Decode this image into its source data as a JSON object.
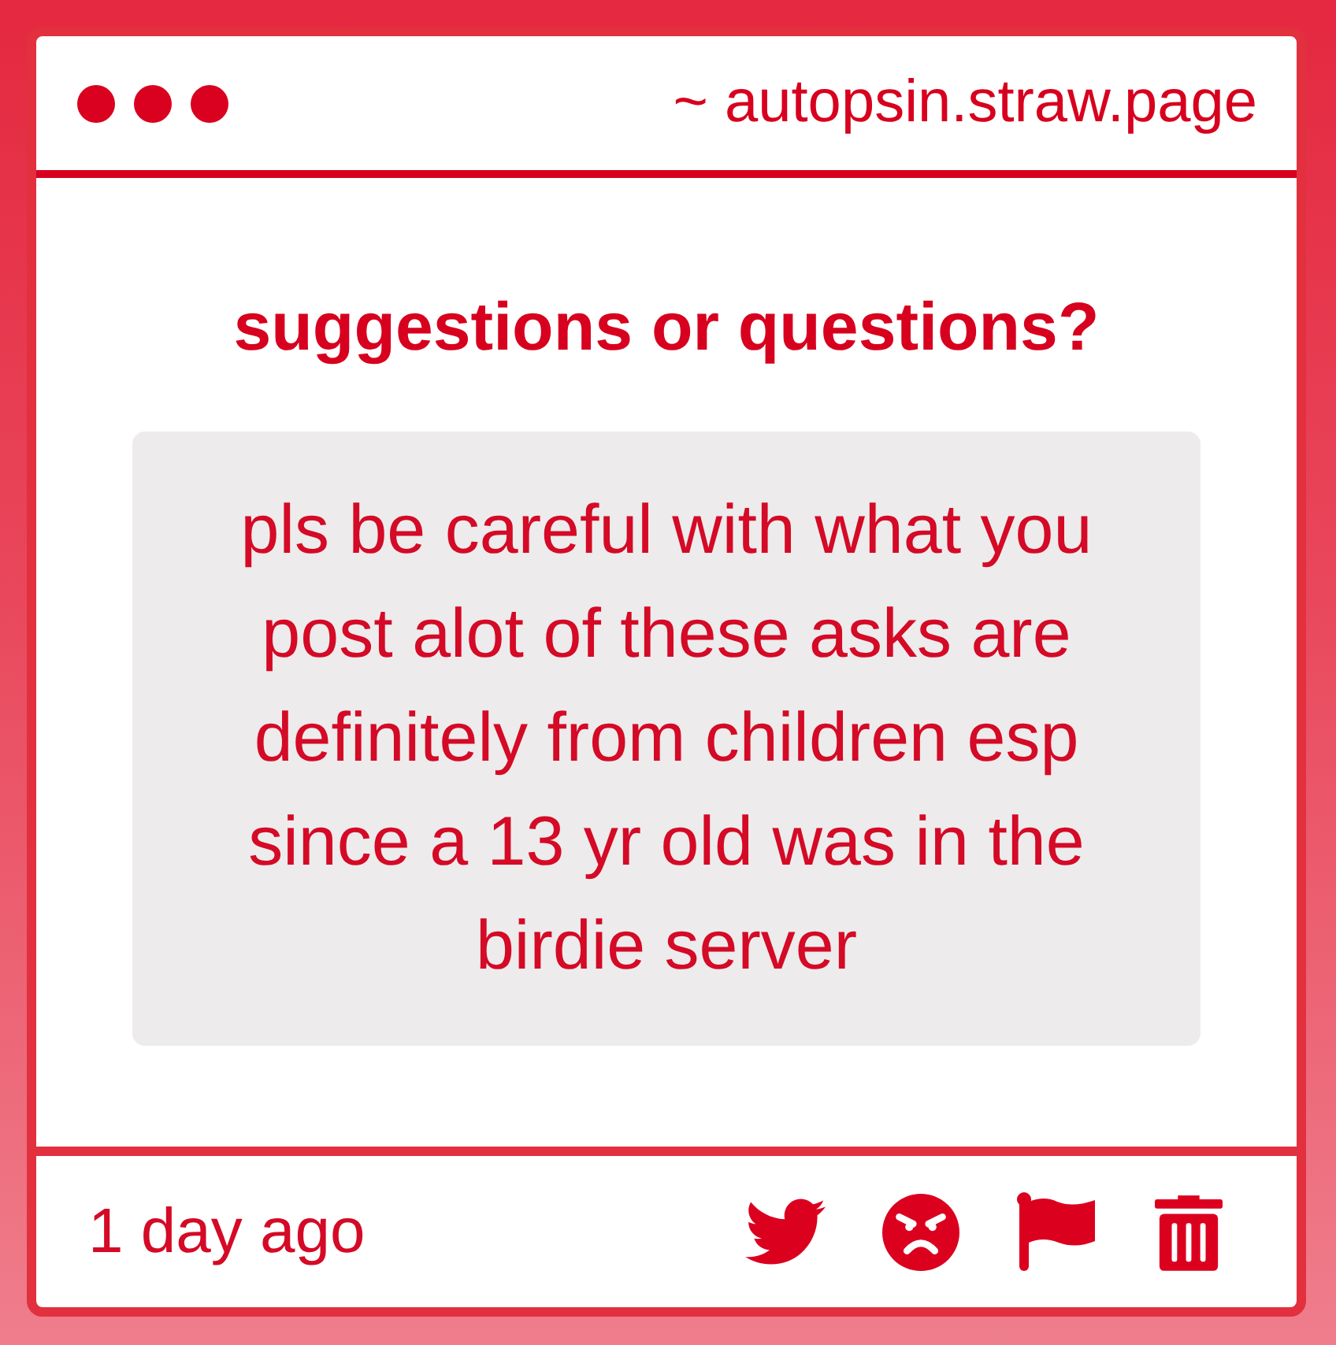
{
  "window": {
    "address": "~ autopsin.straw.page"
  },
  "question": {
    "heading": "suggestions or questions?",
    "message": "pls be careful with what you post alot of these asks are definitely from children esp since a 13 yr old was in the birdie server"
  },
  "footer": {
    "time": "1 day ago"
  }
}
